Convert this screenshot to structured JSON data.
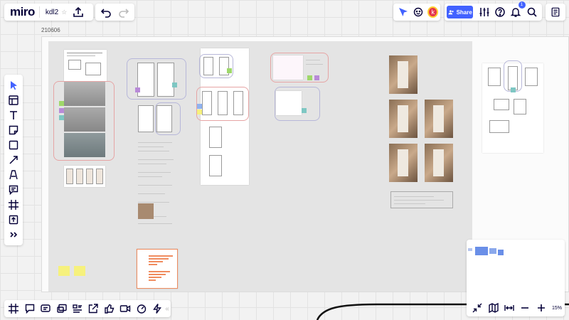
{
  "app": {
    "logo": "miro",
    "board_name": "kdl2"
  },
  "collab": {
    "avatar_initial": "k"
  },
  "header": {
    "share_label": "Share",
    "notifications_count": "1"
  },
  "board": {
    "frame_label": "210606"
  },
  "minimap": {
    "zoom": "15%"
  },
  "colors": {
    "accent": "#4262ff",
    "sticky_yellow": "#f6f17d",
    "sticky_green": "#9fd86a",
    "sticky_purple": "#b88ad8",
    "sticky_teal": "#7ec7c3",
    "sticky_blue": "#8fb2f0"
  },
  "icons": {
    "top": [
      "upload-icon",
      "undo-icon",
      "redo-icon",
      "cursor-send-icon",
      "reactions-icon",
      "settings-sliders-icon",
      "help-icon",
      "bell-icon",
      "search-icon",
      "board-menu-icon"
    ],
    "left_toolbar": [
      "select-icon",
      "templates-icon",
      "text-icon",
      "sticky-note-icon",
      "shape-icon",
      "line-icon",
      "pen-icon",
      "comment-icon",
      "frame-icon",
      "upload-icon",
      "more-icon"
    ],
    "bottom_toolbar": [
      "frames-icon",
      "comment-bubble-icon",
      "chat-icon",
      "screen-share-icon",
      "card-icon",
      "share-out-icon",
      "vote-icon",
      "video-icon",
      "timer-icon",
      "activity-icon",
      "collapse-icon"
    ]
  }
}
